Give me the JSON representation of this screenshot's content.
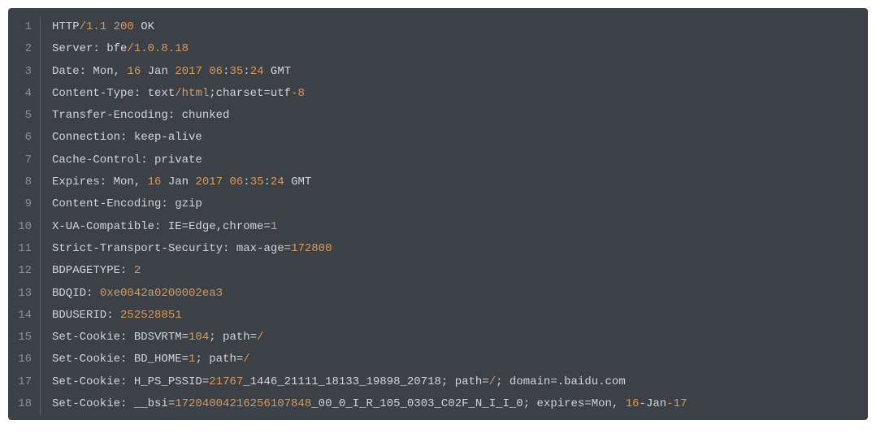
{
  "code": {
    "lines": [
      {
        "num": "1",
        "tokens": [
          [
            "HTTP",
            "default"
          ],
          [
            "/1.1",
            "slash"
          ],
          [
            " ",
            "default"
          ],
          [
            "200",
            "number"
          ],
          [
            " OK",
            "default"
          ]
        ]
      },
      {
        "num": "2",
        "tokens": [
          [
            "Server: bfe",
            "default"
          ],
          [
            "/1.0.8.18",
            "slash"
          ]
        ]
      },
      {
        "num": "3",
        "tokens": [
          [
            "Date: Mon, ",
            "default"
          ],
          [
            "16",
            "number"
          ],
          [
            " Jan ",
            "default"
          ],
          [
            "2017",
            "number"
          ],
          [
            " ",
            "default"
          ],
          [
            "06",
            "number"
          ],
          [
            ":",
            "default"
          ],
          [
            "35",
            "number"
          ],
          [
            ":",
            "default"
          ],
          [
            "24",
            "number"
          ],
          [
            " GMT",
            "default"
          ]
        ]
      },
      {
        "num": "4",
        "tokens": [
          [
            "Content-Type: text",
            "default"
          ],
          [
            "/html",
            "slash"
          ],
          [
            ";charset=utf",
            "default"
          ],
          [
            "-8",
            "number"
          ]
        ]
      },
      {
        "num": "5",
        "tokens": [
          [
            "Transfer-Encoding: chunked",
            "default"
          ]
        ]
      },
      {
        "num": "6",
        "tokens": [
          [
            "Connection: keep-alive",
            "default"
          ]
        ]
      },
      {
        "num": "7",
        "tokens": [
          [
            "Cache-Control: private",
            "default"
          ]
        ]
      },
      {
        "num": "8",
        "tokens": [
          [
            "Expires: Mon, ",
            "default"
          ],
          [
            "16",
            "number"
          ],
          [
            " Jan ",
            "default"
          ],
          [
            "2017",
            "number"
          ],
          [
            " ",
            "default"
          ],
          [
            "06",
            "number"
          ],
          [
            ":",
            "default"
          ],
          [
            "35",
            "number"
          ],
          [
            ":",
            "default"
          ],
          [
            "24",
            "number"
          ],
          [
            " GMT",
            "default"
          ]
        ]
      },
      {
        "num": "9",
        "tokens": [
          [
            "Content-Encoding: gzip",
            "default"
          ]
        ]
      },
      {
        "num": "10",
        "tokens": [
          [
            "X-UA-Compatible: IE=Edge,chrome=",
            "default"
          ],
          [
            "1",
            "number"
          ]
        ]
      },
      {
        "num": "11",
        "tokens": [
          [
            "Strict-Transport-Security: max-age=",
            "default"
          ],
          [
            "172800",
            "number"
          ]
        ]
      },
      {
        "num": "12",
        "tokens": [
          [
            "BDPAGETYPE: ",
            "default"
          ],
          [
            "2",
            "number"
          ]
        ]
      },
      {
        "num": "13",
        "tokens": [
          [
            "BDQID: ",
            "default"
          ],
          [
            "0xe0042a0200002ea3",
            "hex"
          ]
        ]
      },
      {
        "num": "14",
        "tokens": [
          [
            "BDUSERID: ",
            "default"
          ],
          [
            "252528851",
            "number"
          ]
        ]
      },
      {
        "num": "15",
        "tokens": [
          [
            "Set-Cookie: BDSVRTM=",
            "default"
          ],
          [
            "104",
            "number"
          ],
          [
            "; path=",
            "default"
          ],
          [
            "/",
            "slash"
          ]
        ]
      },
      {
        "num": "16",
        "tokens": [
          [
            "Set-Cookie: BD_HOME=",
            "default"
          ],
          [
            "1",
            "number"
          ],
          [
            "; path=",
            "default"
          ],
          [
            "/",
            "slash"
          ]
        ]
      },
      {
        "num": "17",
        "tokens": [
          [
            "Set-Cookie: H_PS_PSSID=",
            "default"
          ],
          [
            "21767",
            "number"
          ],
          [
            "_1446_21111_18133_19898_20718; path=",
            "default"
          ],
          [
            "/",
            "slash"
          ],
          [
            "; domain=.baidu.com",
            "default"
          ]
        ]
      },
      {
        "num": "18",
        "tokens": [
          [
            "Set-Cookie: __bsi=",
            "default"
          ],
          [
            "17204004216256107848",
            "number"
          ],
          [
            "_00_0_I_R_105_0303_C02F_N_I_I_0; expires=Mon, ",
            "default"
          ],
          [
            "16",
            "number"
          ],
          [
            "-Jan",
            "default"
          ],
          [
            "-17",
            "number"
          ]
        ]
      }
    ]
  }
}
